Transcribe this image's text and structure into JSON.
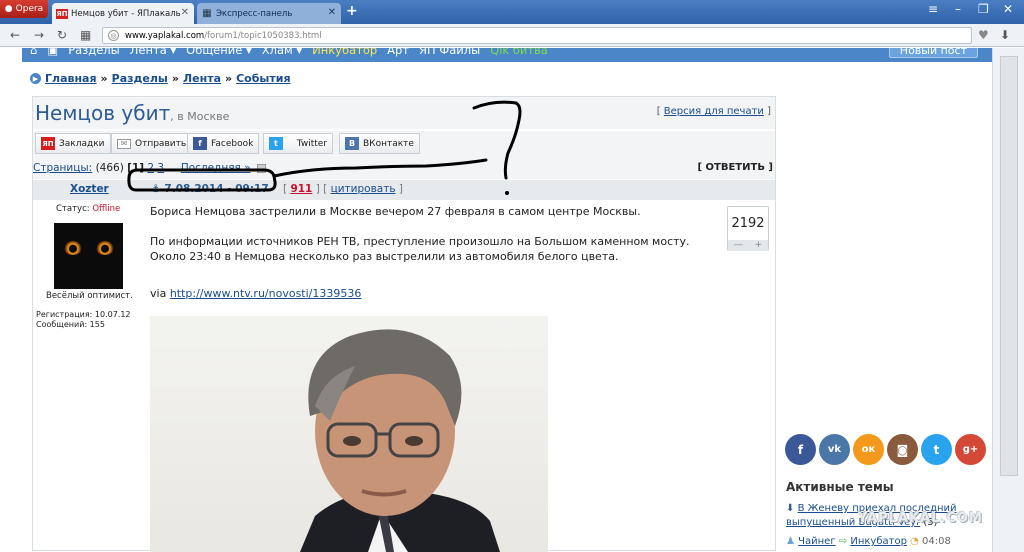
{
  "browser": {
    "opera_label": "Opera",
    "tabs": [
      {
        "label": "Немцов убит - ЯПлакаль",
        "favicon": "ЯП"
      },
      {
        "label": "Экспресс-панель"
      }
    ],
    "url_host": "www.yaplakal.com",
    "url_path": "/forum1/topic1050383.html"
  },
  "topnav": {
    "items": [
      "Разделы",
      "Лента ▾",
      "Общение ▾",
      "Хлам ▾",
      "Инкубатор",
      "Арт",
      "ЯП Файлы",
      "Qik битва"
    ],
    "new_post": "Новый пост"
  },
  "breadcrumbs": [
    "Главная",
    "Разделы",
    "Лента",
    "События"
  ],
  "topic": {
    "title": "Немцов убит",
    "subtitle": ", в Москве",
    "print_version": "Версия для печати"
  },
  "share": [
    {
      "label": "Закладки",
      "icon": "ЯП"
    },
    {
      "label": "Отправить",
      "icon": "mail"
    },
    {
      "label": "Facebook",
      "icon": "f"
    },
    {
      "label": "Twitter",
      "icon": "t"
    },
    {
      "label": "ВКонтакте",
      "icon": "B"
    }
  ],
  "pagination": {
    "label": "Страницы:",
    "total": "(466)",
    "current": "[1]",
    "p2": "2",
    "p3": "3",
    "ellipsis": "...",
    "last": "Последняя »",
    "reply": "[ ОТВЕТИТЬ ]"
  },
  "post": {
    "author": "Xozter",
    "date": "7.08.2014 - 09:17",
    "number": "911",
    "quote": "цитировать",
    "status_label": "Статус:",
    "status_value": "Offline",
    "user_title": "Весёлый оптимист.",
    "reg": "Регистрация: 10.07.12",
    "messages": "Сообщений: 155",
    "paragraph1": "Бориса Немцова застрелили в Москве вечером 27 февраля в самом центре Москвы.",
    "paragraph2": "По информации источников РЕН ТВ, преступление произошло на Большом каменном мосту. Около 23:40 в Немцова несколько раз выстрелили из автомобиля белого цвета.",
    "via": "via",
    "link": "http://www.ntv.ru/novosti/1339536",
    "rating": "2192",
    "rating_minus": "—",
    "rating_plus": "+"
  },
  "annotation": {
    "question_mark": "?",
    "color": "#000000"
  },
  "sidebar": {
    "social": [
      {
        "name": "facebook",
        "glyph": "f",
        "color": "#3b5998"
      },
      {
        "name": "vk",
        "glyph": "vk",
        "color": "#4a76a8"
      },
      {
        "name": "odnoklassniki",
        "glyph": "ок",
        "color": "#f39a1c"
      },
      {
        "name": "instagram",
        "glyph": "◙",
        "color": "#8a5a3c"
      },
      {
        "name": "twitter",
        "glyph": "t",
        "color": "#2aa3ef"
      },
      {
        "name": "google-plus",
        "glyph": "g+",
        "color": "#d34836"
      }
    ],
    "active_title": "Активные темы",
    "active1_link": "В Женеву приехал последний выпущенный Bugatti Veyr",
    "active1_count": "(5)",
    "active2_user": "Чайнег",
    "active2_section": "Инкубатор",
    "active2_time": "04:08"
  },
  "watermark": "YAPLAKAL.COM",
  "colors": {
    "brand_blue": "#4a86c8",
    "link": "#1a4d8f",
    "accent_red": "#c8102e"
  }
}
